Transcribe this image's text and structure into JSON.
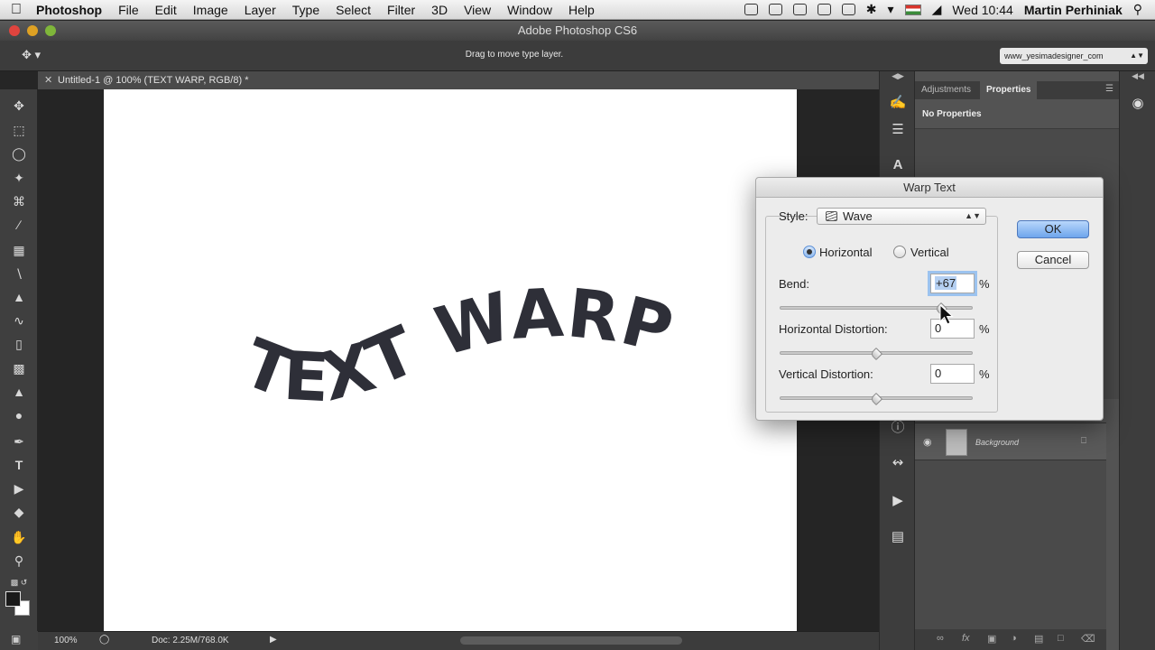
{
  "menubar": {
    "apple": "",
    "items": [
      "Photoshop",
      "File",
      "Edit",
      "Image",
      "Layer",
      "Type",
      "Select",
      "Filter",
      "3D",
      "View",
      "Window",
      "Help"
    ],
    "clock": "Wed 10:44",
    "user": "Martin Perhiniak"
  },
  "window": {
    "title": "Adobe Photoshop CS6"
  },
  "options": {
    "hint": "Drag to move type layer.",
    "workspace": "www_yesimadesigner_com"
  },
  "document": {
    "tab_title": "Untitled-1 @ 100% (TEXT WARP, RGB/8) *",
    "text": "TEXT WARP",
    "zoom": "100%",
    "doc_info": "Doc: 2.25M/768.0K"
  },
  "panels": {
    "tabs": [
      "Adjustments",
      "Properties"
    ],
    "active_tab": "Properties",
    "no_properties": "No Properties",
    "layer_name": "Background"
  },
  "warp_dialog": {
    "title": "Warp Text",
    "style_label": "Style:",
    "style_value": "Wave",
    "orientation": {
      "horizontal": "Horizontal",
      "vertical": "Vertical",
      "selected": "horizontal"
    },
    "bend_label": "Bend:",
    "bend_value": "+67",
    "bend": 67,
    "hdist_label": "Horizontal Distortion:",
    "hdist_value": "0",
    "hdist": 0,
    "vdist_label": "Vertical Distortion:",
    "vdist_value": "0",
    "vdist": 0,
    "pct": "%",
    "ok": "OK",
    "cancel": "Cancel"
  }
}
